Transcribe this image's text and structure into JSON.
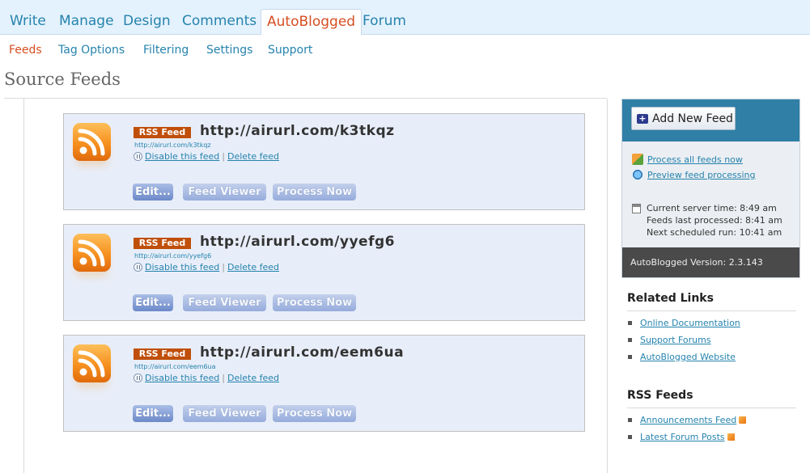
{
  "top_tabs": [
    "Write",
    "Manage",
    "Design",
    "Comments",
    "AutoBlogged",
    "Forum"
  ],
  "sub_tabs": [
    "Feeds",
    "Tag Options",
    "Filtering",
    "Settings",
    "Support"
  ],
  "page_title": "Source Feeds",
  "feeds": [
    {
      "badge": "RSS Feed",
      "url": "http://airurl.com/k3tkqz",
      "small_url": "http://airurl.com/k3tkqz",
      "disable": "Disable this feed",
      "delete": "Delete feed",
      "edit": "Edit...",
      "viewer": "Feed Viewer",
      "process": "Process Now"
    },
    {
      "badge": "RSS Feed",
      "url": "http://airurl.com/yyefg6",
      "small_url": "http://airurl.com/yyefg6",
      "disable": "Disable this feed",
      "delete": "Delete feed",
      "edit": "Edit...",
      "viewer": "Feed Viewer",
      "process": "Process Now"
    },
    {
      "badge": "RSS Feed",
      "url": "http://airurl.com/eem6ua",
      "small_url": "http://airurl.com/eem6ua",
      "disable": "Disable this feed",
      "delete": "Delete feed",
      "edit": "Edit...",
      "viewer": "Feed Viewer",
      "process": "Process Now"
    }
  ],
  "panel": {
    "add_button": "Add New Feed",
    "process_all": "Process all feeds now",
    "preview": "Preview feed processing",
    "server_time": "Current server time: 8:49 am",
    "last_processed": "Feeds last processed: 8:41 am",
    "next_run": "Next scheduled run: 10:41 am",
    "version": "AutoBlogged Version: 2.3.143"
  },
  "related": {
    "heading": "Related Links",
    "links": [
      "Online Documentation",
      "Support Forums",
      "AutoBlogged Website"
    ]
  },
  "rss_feeds": {
    "heading": "RSS Feeds",
    "links": [
      "Announcements Feed",
      "Latest Forum Posts"
    ]
  },
  "colors": {
    "accent": "#d54e21",
    "link": "#2583ad",
    "header_bg": "#e4f2fd",
    "panel_top": "#2f7fa7"
  },
  "icons": {
    "feed": "rss-icon",
    "disable": "pause-icon",
    "add": "plus-icon",
    "process": "process-icon",
    "preview": "preview-icon",
    "time": "calendar-icon"
  }
}
